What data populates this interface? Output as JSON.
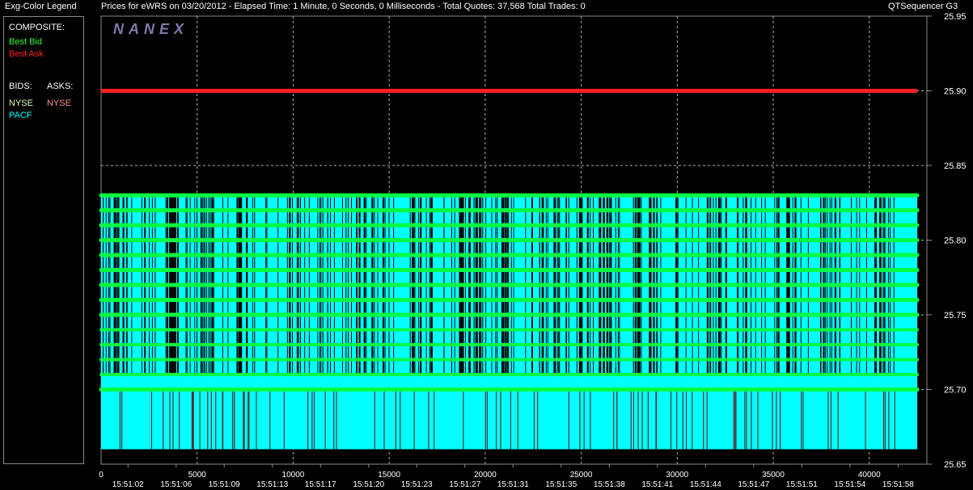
{
  "window": {
    "legend_title": "Exg-Color Legend",
    "chart_title": "Prices for  eWRS  on  03/20/2012  -  Elapsed Time: 1 Minute, 0 Seconds, 0 Milliseconds  -  Total Quotes: 37,568  Total Trades: 0",
    "app_name": "QTSequencer G3",
    "watermark": "NANEX"
  },
  "legend": {
    "composite_label": "COMPOSITE:",
    "best_bid": "Best Bid",
    "best_ask": "Best Ask",
    "bids_label": "BIDS:",
    "asks_label": "ASKS:",
    "bid_exchanges": [
      "NYSE",
      "PACF"
    ],
    "ask_exchanges": [
      "NYSE"
    ]
  },
  "colors": {
    "best_bid": "#33ff33",
    "best_ask": "#ff2020",
    "nyse_bid": "#e0ffb0",
    "pacf_bid": "#00ffff",
    "nyse_ask": "#ff8c8c",
    "bid_fill": "#00ffff",
    "bid_dots": "#00ff44",
    "grid": "#b0b0b0"
  },
  "chart_data": {
    "type": "line",
    "ylim": [
      25.65,
      25.95
    ],
    "y_ticks": [
      "25.95",
      "25.90",
      "25.85",
      "25.80",
      "25.75",
      "25.70",
      "25.65"
    ],
    "xlim": [
      0,
      43000
    ],
    "x_ticks": [
      "0",
      "5000",
      "10000",
      "15000",
      "20000",
      "25000",
      "30000",
      "35000",
      "40000"
    ],
    "x_time_labels": [
      "15:51:02",
      "15:51:06",
      "15:51:09",
      "15:51:13",
      "15:51:17",
      "15:51:20",
      "15:51:23",
      "15:51:27",
      "15:51:31",
      "15:51:35",
      "15:51:38",
      "15:51:41",
      "15:51:44",
      "15:51:47",
      "15:51:51",
      "15:51:54",
      "15:51:58"
    ],
    "series": [
      {
        "name": "Best Ask",
        "values": [
          25.9,
          25.9
        ]
      },
      {
        "name": "Best Bid",
        "values": [
          25.83,
          25.66
        ]
      }
    ],
    "bid_price_levels": [
      25.83,
      25.82,
      25.81,
      25.8,
      25.79,
      25.78,
      25.77,
      25.76,
      25.75,
      25.74,
      25.73,
      25.72,
      25.71,
      25.7
    ],
    "bid_range": [
      25.66,
      25.83
    ]
  }
}
